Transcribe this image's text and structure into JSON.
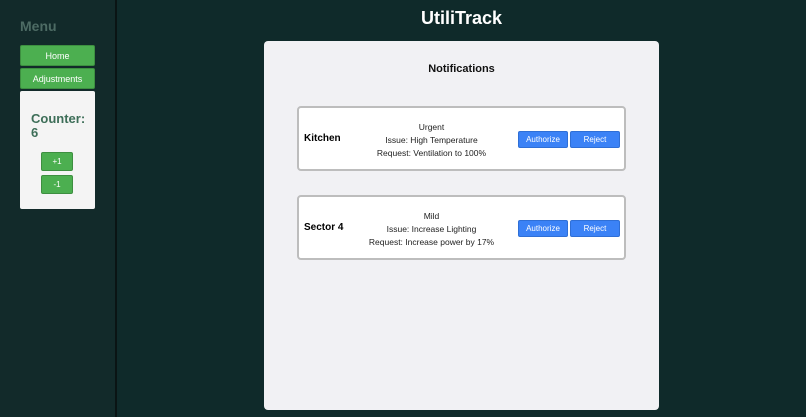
{
  "sidebar": {
    "title": "Menu",
    "items": [
      {
        "label": "Home"
      },
      {
        "label": "Adjustments"
      }
    ],
    "counter": {
      "label": "Counter:",
      "value": "6",
      "increment_label": "+1",
      "decrement_label": "-1"
    }
  },
  "header": {
    "title": "UtiliTrack"
  },
  "notifications": {
    "title": "Notifications",
    "items": [
      {
        "location": "Kitchen",
        "severity": "Urgent",
        "issue": "Issue: High Temperature",
        "request": "Request: Ventilation to 100%",
        "authorize_label": "Authorize",
        "reject_label": "Reject"
      },
      {
        "location": "Sector 4",
        "severity": "Mild",
        "issue": "Issue: Increase Lighting",
        "request": "Request: Increase power by 17%",
        "authorize_label": "Authorize",
        "reject_label": "Reject"
      }
    ]
  },
  "colors": {
    "background": "#0f2a2a",
    "nav_button": "#4caf50",
    "action_button": "#3b82f6",
    "panel": "#f1f1f4"
  }
}
